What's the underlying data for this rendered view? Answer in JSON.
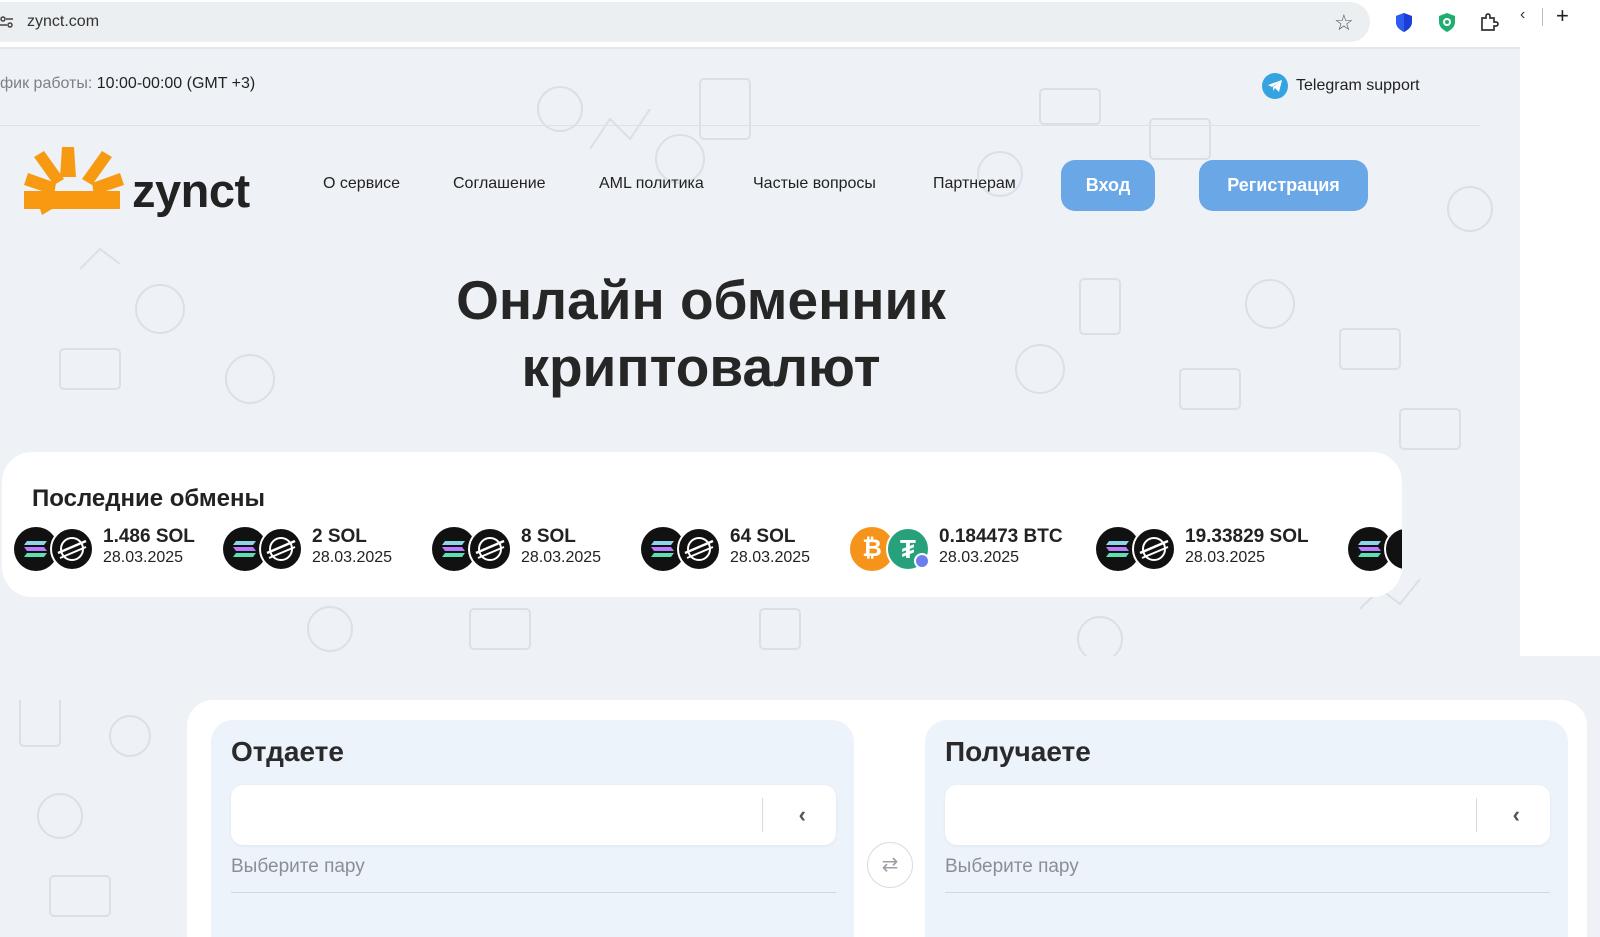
{
  "browser": {
    "url": "zynct.com",
    "tab_nav_chevron": "‹",
    "new_tab": "+"
  },
  "topbar": {
    "hours_label": "фик работы:",
    "hours_value": "10:00-00:00 (GMT +3)",
    "telegram_label": "Telegram support"
  },
  "header": {
    "logo_text": "zynct",
    "nav": [
      "О сервисе",
      "Соглашение",
      "AML политика",
      "Частые вопросы",
      "Партнерам"
    ],
    "login_label": "Вход",
    "register_label": "Регистрация"
  },
  "hero": {
    "line1": "Онлайн обменник",
    "line2": "криптовалют"
  },
  "recent": {
    "title": "Последние обмены",
    "items": [
      {
        "amount": "1.486 SOL",
        "date": "28.03.2025",
        "pair": "sol-xlm"
      },
      {
        "amount": "2 SOL",
        "date": "28.03.2025",
        "pair": "sol-xlm"
      },
      {
        "amount": "8 SOL",
        "date": "28.03.2025",
        "pair": "sol-xlm"
      },
      {
        "amount": "64 SOL",
        "date": "28.03.2025",
        "pair": "sol-xlm"
      },
      {
        "amount": "0.184473 BTC",
        "date": "28.03.2025",
        "pair": "btc-usdt"
      },
      {
        "amount": "19.33829 SOL",
        "date": "28.03.2025",
        "pair": "sol-xlm"
      }
    ]
  },
  "exchange": {
    "give_title": "Отдаете",
    "get_title": "Получаете",
    "give_hint": "Выберите пару",
    "get_hint": "Выберите пару",
    "chevron": "‹",
    "swap_icon": "⇄"
  },
  "colors": {
    "accent": "#6aa7e6",
    "logo_orange": "#f79a12",
    "page_bg": "#eef2f7",
    "telegram": "#34a3e0"
  }
}
